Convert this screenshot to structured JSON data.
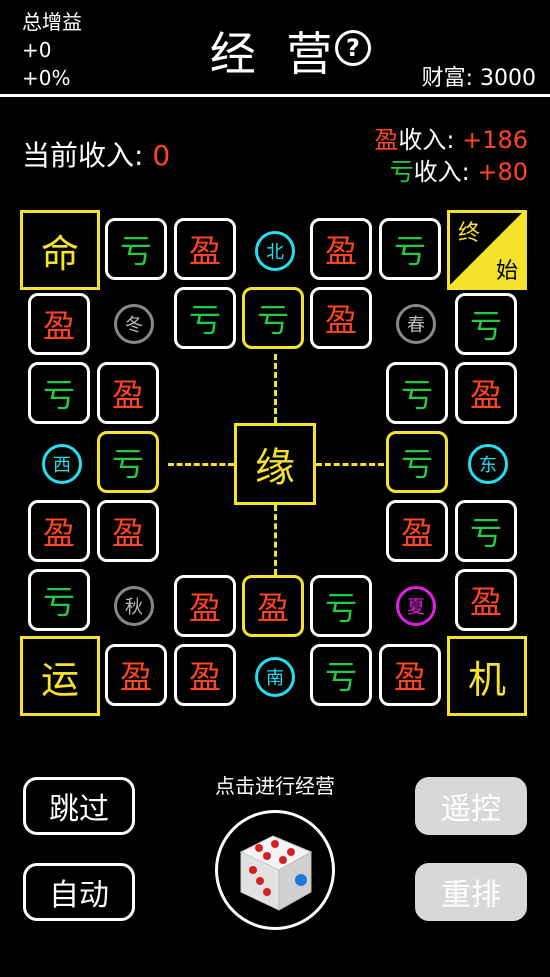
{
  "header": {
    "gain_title": "总增益",
    "gain_value": "+0",
    "gain_percent": "+0%",
    "title": "经 营",
    "help": "?",
    "wealth_label": "财富:",
    "wealth_value": "3000"
  },
  "income": {
    "current_label": "当前收入:",
    "current_value": "0",
    "ying_prefix": "盈",
    "ying_label": "收入:",
    "ying_value": "+186",
    "kui_prefix": "亏",
    "kui_label": "收入:",
    "kui_value": "+80"
  },
  "corners": {
    "ming": "命",
    "end": "终",
    "start": "始",
    "yun": "运",
    "ji": "机"
  },
  "center": "缘",
  "seasons": {
    "north": "北",
    "south": "南",
    "east": "东",
    "west": "西",
    "winter": "冬",
    "spring": "春",
    "autumn": "秋",
    "summer": "夏"
  },
  "tiles": [
    {
      "t": "亏",
      "k": "k"
    },
    {
      "t": "盈",
      "k": "y"
    },
    {
      "t": "盈",
      "k": "y"
    },
    {
      "t": "亏",
      "k": "k"
    },
    {
      "t": "盈",
      "k": "y"
    },
    {
      "t": "亏",
      "k": "k"
    },
    {
      "t": "亏",
      "k": "k"
    },
    {
      "t": "盈",
      "k": "y"
    },
    {
      "t": "亏",
      "k": "k"
    },
    {
      "t": "亏",
      "k": "k"
    },
    {
      "t": "盈",
      "k": "y"
    },
    {
      "t": "亏",
      "k": "k"
    },
    {
      "t": "盈",
      "k": "y"
    },
    {
      "t": "亏",
      "k": "k"
    },
    {
      "t": "亏",
      "k": "k"
    },
    {
      "t": "盈",
      "k": "y"
    },
    {
      "t": "盈",
      "k": "y"
    },
    {
      "t": "盈",
      "k": "y"
    },
    {
      "t": "亏",
      "k": "k"
    },
    {
      "t": "亏",
      "k": "k"
    },
    {
      "t": "盈",
      "k": "y"
    },
    {
      "t": "盈",
      "k": "y"
    },
    {
      "t": "亏",
      "k": "k"
    },
    {
      "t": "盈",
      "k": "y"
    },
    {
      "t": "盈",
      "k": "y"
    },
    {
      "t": "盈",
      "k": "y"
    },
    {
      "t": "亏",
      "k": "k"
    },
    {
      "t": "盈",
      "k": "y"
    }
  ],
  "buttons": {
    "skip": "跳过",
    "auto": "自动",
    "remote": "遥控",
    "reshuffle": "重排",
    "dice_hint": "点击进行经营"
  }
}
